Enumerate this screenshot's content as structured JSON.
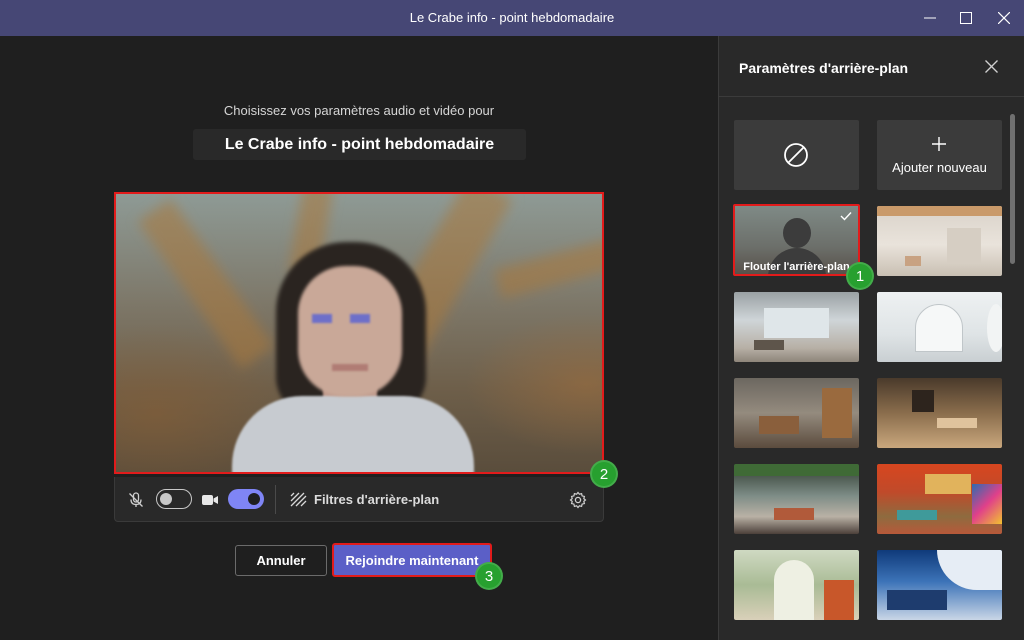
{
  "window": {
    "title": "Le Crabe info - point hebdomadaire",
    "controls": [
      "minimize-icon",
      "maximize-icon",
      "close-icon"
    ]
  },
  "prejoin": {
    "subtitle": "Choisissez vos paramètres audio et vidéo pour",
    "meeting_title": "Le Crabe info - point hebdomadaire",
    "controls": {
      "mic_icon": "mic-off-icon",
      "mic_on": false,
      "camera_icon": "camera-icon",
      "camera_on": true,
      "filters_label": "Filtres d'arrière-plan",
      "settings_icon": "gear-icon"
    },
    "cancel_label": "Annuler",
    "join_label": "Rejoindre maintenant"
  },
  "badges": {
    "one": "1",
    "two": "2",
    "three": "3"
  },
  "panel": {
    "title": "Paramètres d'arrière-plan",
    "none_icon": "no-background-icon",
    "add_new_label": "Ajouter nouveau",
    "blur_label": "Flouter l'arrière-plan",
    "selected": "blur"
  },
  "colors": {
    "titlebar": "#464775",
    "accent": "#5b5fc7",
    "toggle_on": "#7f85f5",
    "highlight": "#e21b1b",
    "badge": "#27a02f"
  }
}
